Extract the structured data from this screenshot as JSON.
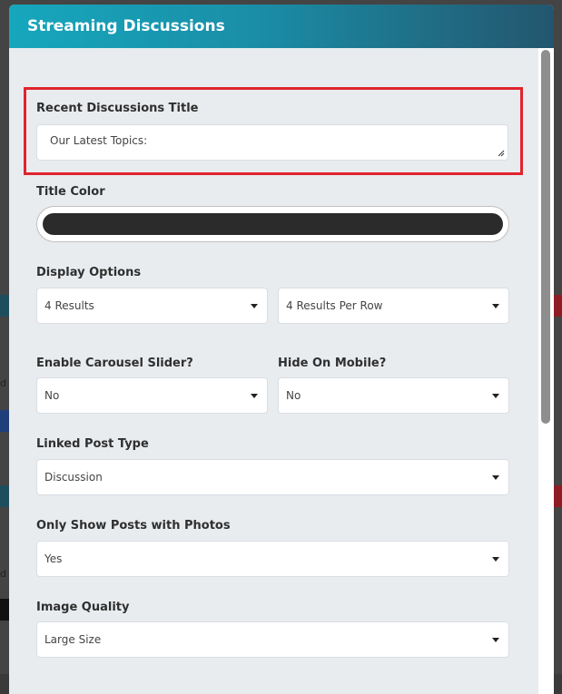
{
  "modal": {
    "title": "Streaming Discussions"
  },
  "fields": {
    "recent_title": {
      "label": "Recent Discussions Title",
      "value": "Our Latest Topics:"
    },
    "title_color": {
      "label": "Title Color",
      "swatch": "#2b2b2b"
    },
    "display_options": {
      "label": "Display Options",
      "results": "4 Results",
      "per_row": "4 Results Per Row"
    },
    "carousel": {
      "label": "Enable Carousel Slider?",
      "value": "No"
    },
    "hide_mobile": {
      "label": "Hide On Mobile?",
      "value": "No"
    },
    "linked_post_type": {
      "label": "Linked Post Type",
      "value": "Discussion"
    },
    "photos_only": {
      "label": "Only Show Posts with Photos",
      "value": "Yes"
    },
    "image_quality": {
      "label": "Image Quality",
      "value": "Large Size"
    }
  },
  "colors": {
    "header_start": "#16a7bd",
    "header_end": "#23566e",
    "highlight": "#e0242e",
    "background": "#e9ecef"
  },
  "backdrop": {
    "letter_d": "d"
  }
}
